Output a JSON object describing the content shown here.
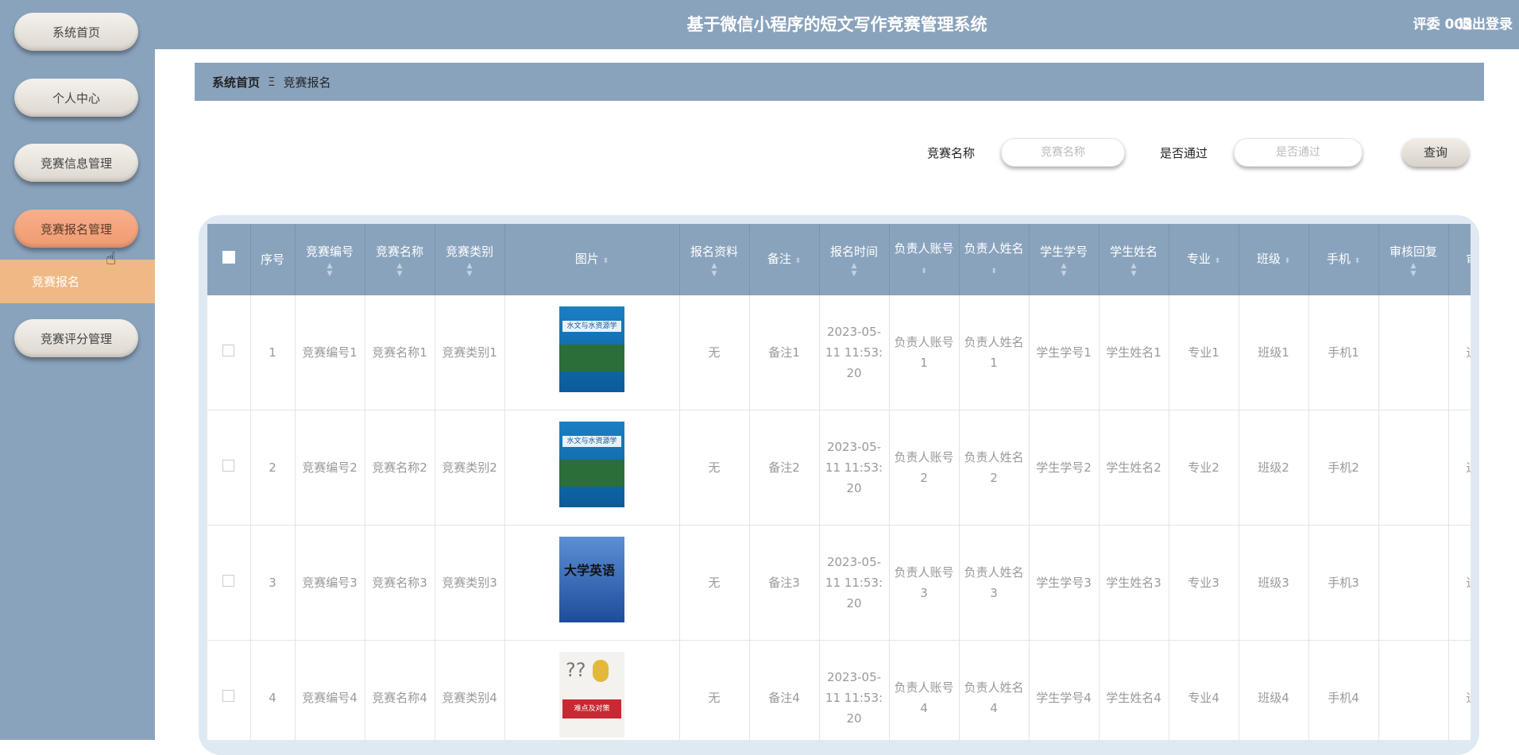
{
  "header": {
    "title": "基于微信小程序的短文写作竞赛管理系统",
    "user": "评委 003",
    "logout": "退出登录"
  },
  "sidebar": {
    "items": [
      {
        "label": "系统首页"
      },
      {
        "label": "个人中心"
      },
      {
        "label": "竞赛信息管理"
      },
      {
        "label": "竞赛报名管理"
      },
      {
        "label": "竞赛评分管理"
      }
    ],
    "sub_item": "竞赛报名"
  },
  "breadcrumb": {
    "home": "系统首页",
    "separator": "Ξ",
    "current": "竞赛报名"
  },
  "filters": {
    "name_label": "竞赛名称",
    "name_placeholder": "竞赛名称",
    "pass_label": "是否通过",
    "pass_placeholder": "是否通过",
    "query_label": "查询"
  },
  "table": {
    "columns": [
      "序号",
      "竞赛编号",
      "竞赛名称",
      "竞赛类别",
      "图片",
      "报名资料",
      "备注",
      "报名时间",
      "负责人账号",
      "负责人姓名",
      "学生学号",
      "学生姓名",
      "专业",
      "班级",
      "手机",
      "审核回复",
      "审"
    ],
    "rows": [
      {
        "index": "1",
        "code": "竞赛编号1",
        "name": "竞赛名称1",
        "category": "竞赛类别1",
        "material": "无",
        "note": "备注1",
        "time": "2023-05-11 11:53:20",
        "account": "负责人账号1",
        "leader": "负责人姓名1",
        "student_id": "学生学号1",
        "student_name": "学生姓名1",
        "major": "专业1",
        "class": "班级1",
        "phone": "手机1",
        "reply": "",
        "status": "通"
      },
      {
        "index": "2",
        "code": "竞赛编号2",
        "name": "竞赛名称2",
        "category": "竞赛类别2",
        "material": "无",
        "note": "备注2",
        "time": "2023-05-11 11:53:20",
        "account": "负责人账号2",
        "leader": "负责人姓名2",
        "student_id": "学生学号2",
        "student_name": "学生姓名2",
        "major": "专业2",
        "class": "班级2",
        "phone": "手机2",
        "reply": "",
        "status": "通"
      },
      {
        "index": "3",
        "code": "竞赛编号3",
        "name": "竞赛名称3",
        "category": "竞赛类别3",
        "material": "无",
        "note": "备注3",
        "time": "2023-05-11 11:53:20",
        "account": "负责人账号3",
        "leader": "负责人姓名3",
        "student_id": "学生学号3",
        "student_name": "学生姓名3",
        "major": "专业3",
        "class": "班级3",
        "phone": "手机3",
        "reply": "",
        "status": "通"
      },
      {
        "index": "4",
        "code": "竞赛编号4",
        "name": "竞赛名称4",
        "category": "竞赛类别4",
        "material": "无",
        "note": "备注4",
        "time": "2023-05-11 11:53:20",
        "account": "负责人账号4",
        "leader": "负责人姓名4",
        "student_id": "学生学号4",
        "student_name": "学生姓名4",
        "major": "专业4",
        "class": "班级4",
        "phone": "手机4",
        "reply": "",
        "status": "通"
      }
    ]
  },
  "book_covers": {
    "book1_title": "水文与水资源学",
    "book2_title": "大学英语",
    "book3_title": "难点及对策"
  },
  "colors": {
    "primary": "#8aa3bd",
    "active": "#ef9a72",
    "sub_item": "#efb985"
  }
}
